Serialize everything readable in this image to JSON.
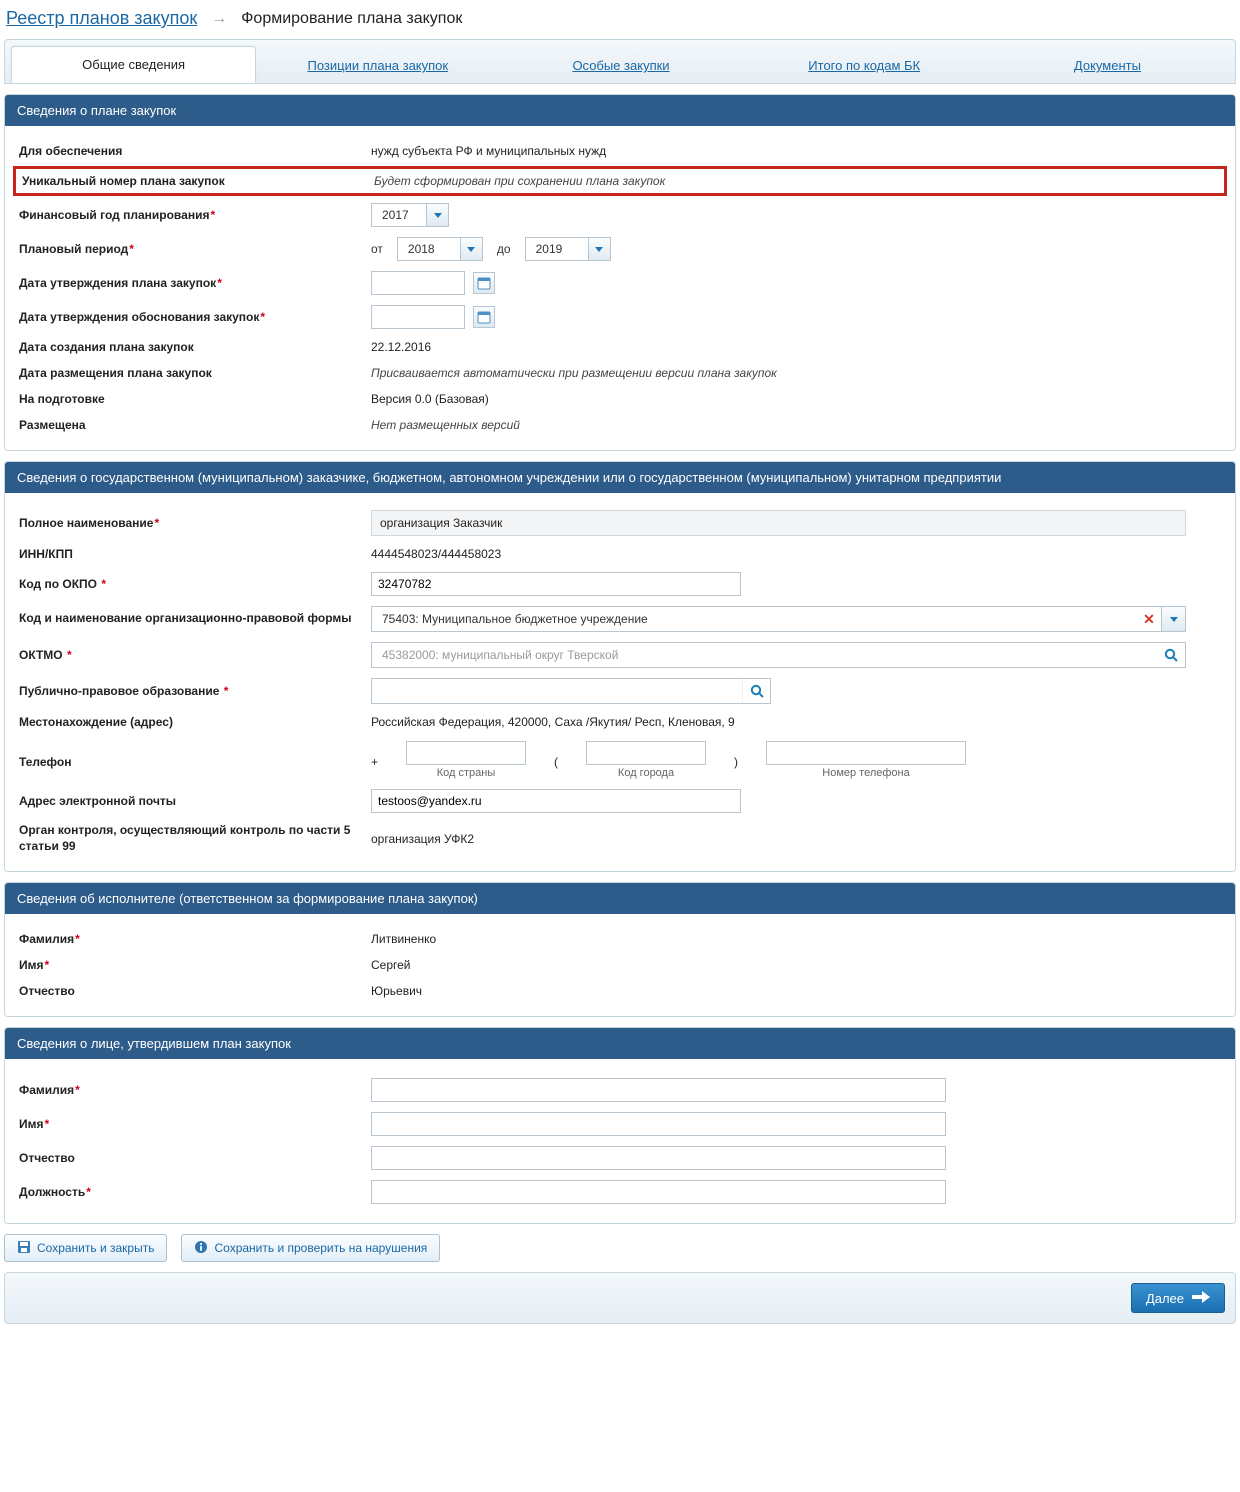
{
  "breadcrumb": {
    "root": "Реестр планов закупок",
    "current": "Формирование плана закупок"
  },
  "tabs": [
    "Общие сведения",
    "Позиции плана закупок",
    "Особые закупки",
    "Итого по кодам БК",
    "Документы"
  ],
  "section_plan": {
    "title": "Сведения о плане закупок",
    "labels": {
      "for_needs": "Для обеспечения",
      "unique_num": "Уникальный номер плана закупок",
      "fin_year": "Финансовый год планирования",
      "plan_period": "Плановый период",
      "plan_from": "от",
      "plan_to": "до",
      "approval_date": "Дата утверждения плана закупок",
      "justification_date": "Дата утверждения обоснования закупок",
      "created_date": "Дата создания плана закупок",
      "placed_date": "Дата размещения плана закупок",
      "in_prep": "На подготовке",
      "placed": "Размещена"
    },
    "values": {
      "for_needs": "нужд субъекта РФ и муниципальных нужд",
      "unique_num": "Будет сформирован при сохранении плана закупок",
      "fin_year": "2017",
      "period_from": "2018",
      "period_to": "2019",
      "approval_date": "",
      "justification_date": "",
      "created_date": "22.12.2016",
      "placed_date": "Присваивается автоматически при размещении версии плана закупок",
      "in_prep": "Версия 0.0 (Базовая)",
      "placed": "Нет размещенных версий"
    }
  },
  "section_customer": {
    "title": "Сведения о государственном (муниципальном) заказчике, бюджетном, автономном учреждении или о государственном (муниципальном) унитарном предприятии",
    "labels": {
      "full_name": "Полное наименование",
      "inn_kpp": "ИНН/КПП",
      "okpo": "Код по ОКПО",
      "opf": "Код и наименование организационно-правовой формы",
      "oktmo": "ОКТМО",
      "ppo": "Публично-правовое образование",
      "address": "Местонахождение (адрес)",
      "phone": "Телефон",
      "phone_country": "Код страны",
      "phone_city": "Код города",
      "phone_number": "Номер телефона",
      "email": "Адрес электронной почты",
      "control_org": "Орган контроля, осуществляющий контроль по части 5 статьи 99"
    },
    "values": {
      "full_name": "организация Заказчик",
      "inn_kpp": "4444548023/444458023",
      "okpo": "32470782",
      "opf": "75403: Муниципальное бюджетное учреждение",
      "oktmo_placeholder": "45382000: муниципальный округ Тверской",
      "ppo": "",
      "address": "Российская Федерация, 420000, Саха /Якутия/ Респ, Кленовая, 9",
      "phone_plus": "+",
      "phone_lpar": "(",
      "phone_rpar": ")",
      "phone_country": "",
      "phone_city": "",
      "phone_number": "",
      "email": "testoos@yandex.ru",
      "control_org": "организация УФК2"
    }
  },
  "section_executor": {
    "title": "Сведения об исполнителе (ответственном за формирование плана закупок)",
    "labels": {
      "surname": "Фамилия",
      "name": "Имя",
      "patronymic": "Отчество"
    },
    "values": {
      "surname": "Литвиненко",
      "name": "Сергей",
      "patronymic": "Юрьевич"
    }
  },
  "section_approver": {
    "title": "Сведения о лице, утвердившем план закупок",
    "labels": {
      "surname": "Фамилия",
      "name": "Имя",
      "patronymic": "Отчество",
      "position": "Должность"
    },
    "values": {
      "surname": "",
      "name": "",
      "patronymic": "",
      "position": ""
    }
  },
  "buttons": {
    "save_close": "Сохранить и закрыть",
    "save_check": "Сохранить и проверить на нарушения",
    "next": "Далее"
  }
}
